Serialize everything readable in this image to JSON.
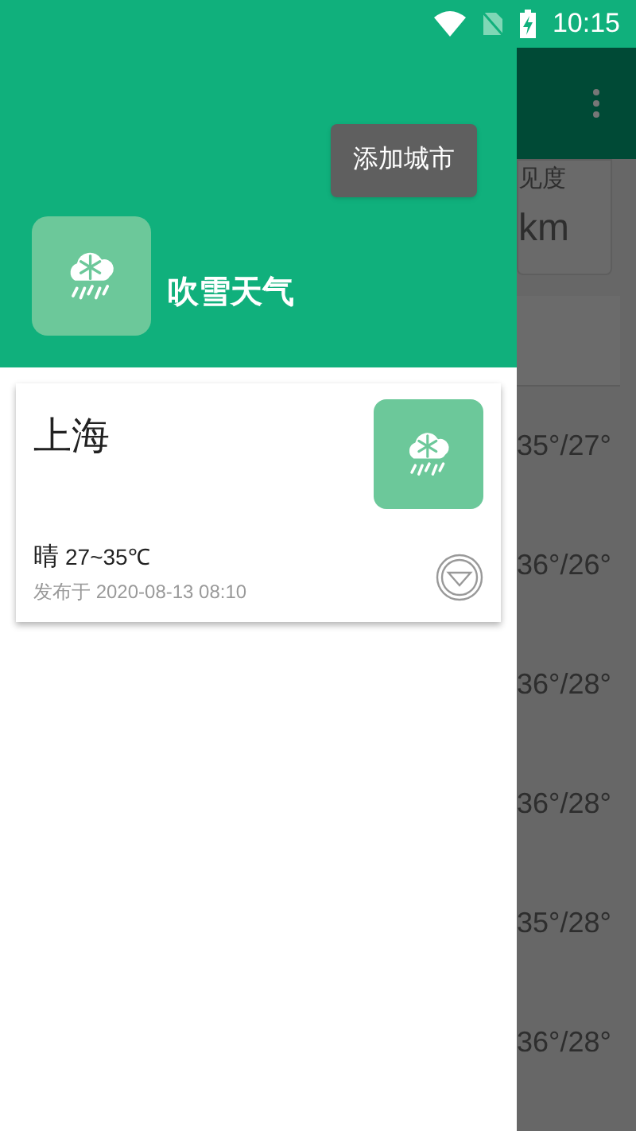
{
  "status_bar": {
    "time": "10:15"
  },
  "background": {
    "card_label": "见度",
    "card_value": "km",
    "forecast": [
      {
        "temps": "35°/27°"
      },
      {
        "temps": "36°/26°"
      },
      {
        "temps": "36°/28°"
      },
      {
        "temps": "36°/28°"
      },
      {
        "temps": "35°/28°"
      },
      {
        "temps": "36°/28°"
      }
    ]
  },
  "drawer": {
    "add_city_button": "添加城市",
    "app_name": "吹雪天气",
    "cities": [
      {
        "name": "上海",
        "condition": "晴",
        "temperature": "27~35℃",
        "published": "发布于 2020-08-13 08:10"
      }
    ]
  }
}
